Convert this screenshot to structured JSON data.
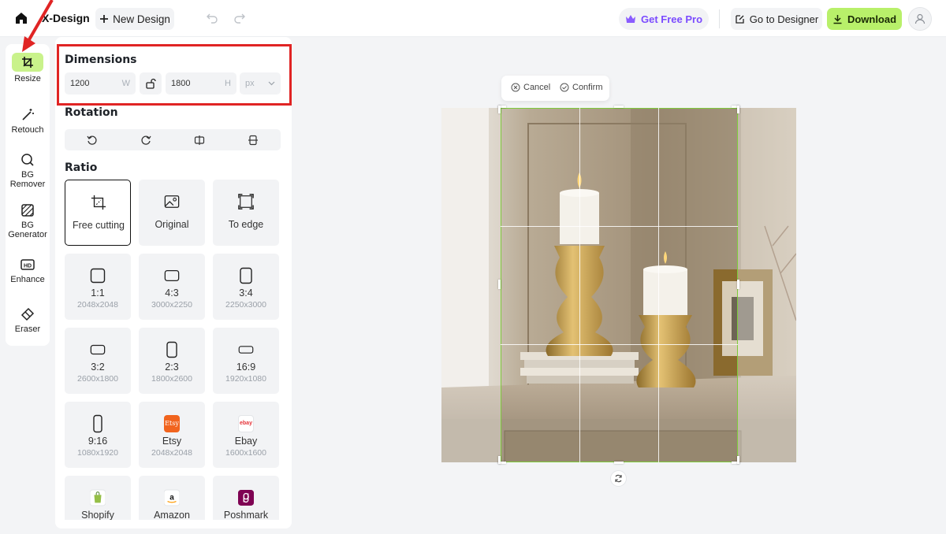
{
  "app": {
    "brand": "X-Design",
    "new_design": "New Design"
  },
  "header": {
    "get_pro": "Get Free Pro",
    "go_to_designer": "Go to Designer",
    "download": "Download"
  },
  "colors": {
    "accent_green": "#b8f06a",
    "pro_purple": "#7b4bff",
    "highlight_red": "#e02424",
    "crop_green": "#7ecb3a"
  },
  "tools": [
    {
      "label": "Resize",
      "icon": "crop-icon",
      "active": true
    },
    {
      "label": "Retouch",
      "icon": "magic-wand-icon"
    },
    {
      "label": "BG Remover",
      "icon": "bg-remover-icon"
    },
    {
      "label": "BG Generator",
      "icon": "bg-generator-icon"
    },
    {
      "label": "Enhance",
      "icon": "hd-icon"
    },
    {
      "label": "Eraser",
      "icon": "eraser-icon"
    }
  ],
  "dimensions": {
    "title": "Dimensions",
    "width": "1200",
    "width_suffix": "W",
    "height": "1800",
    "height_suffix": "H",
    "unit": "px"
  },
  "rotation": {
    "title": "Rotation"
  },
  "ratio": {
    "title": "Ratio",
    "items": [
      {
        "label": "Free cutting",
        "sub": ""
      },
      {
        "label": "Original",
        "sub": ""
      },
      {
        "label": "To edge",
        "sub": ""
      },
      {
        "label": "1:1",
        "sub": "2048x2048"
      },
      {
        "label": "4:3",
        "sub": "3000x2250"
      },
      {
        "label": "3:4",
        "sub": "2250x3000"
      },
      {
        "label": "3:2",
        "sub": "2600x1800"
      },
      {
        "label": "2:3",
        "sub": "1800x2600"
      },
      {
        "label": "16:9",
        "sub": "1920x1080"
      },
      {
        "label": "9:16",
        "sub": "1080x1920"
      },
      {
        "label": "Etsy",
        "sub": "2048x2048"
      },
      {
        "label": "Ebay",
        "sub": "1600x1600"
      },
      {
        "label": "Shopify",
        "sub": ""
      },
      {
        "label": "Amazon",
        "sub": ""
      },
      {
        "label": "Poshmark",
        "sub": ""
      }
    ]
  },
  "crop": {
    "cancel": "Cancel",
    "confirm": "Confirm"
  },
  "badges": {
    "etsy": "Etsy",
    "ebay": "ebay"
  }
}
